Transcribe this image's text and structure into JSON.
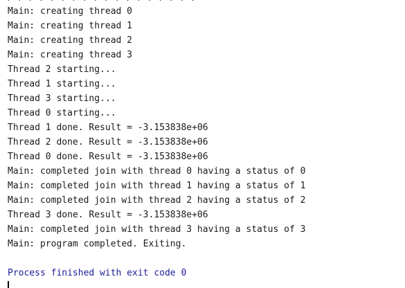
{
  "console": {
    "lines": [
      "Main: creating thread 0",
      "Main: creating thread 1",
      "Main: creating thread 2",
      "Main: creating thread 3",
      "Thread 2 starting...",
      "Thread 1 starting...",
      "Thread 3 starting...",
      "Thread 0 starting...",
      "Thread 1 done. Result = -3.153838e+06",
      "Thread 2 done. Result = -3.153838e+06",
      "Thread 0 done. Result = -3.153838e+06",
      "Main: completed join with thread 0 having a status of 0",
      "Main: completed join with thread 1 having a status of 1",
      "Main: completed join with thread 2 having a status of 2",
      "Thread 3 done. Result = -3.153838e+06",
      "Main: completed join with thread 3 having a status of 3",
      "Main: program completed. Exiting."
    ],
    "exit_message": "Process finished with exit code 0"
  }
}
